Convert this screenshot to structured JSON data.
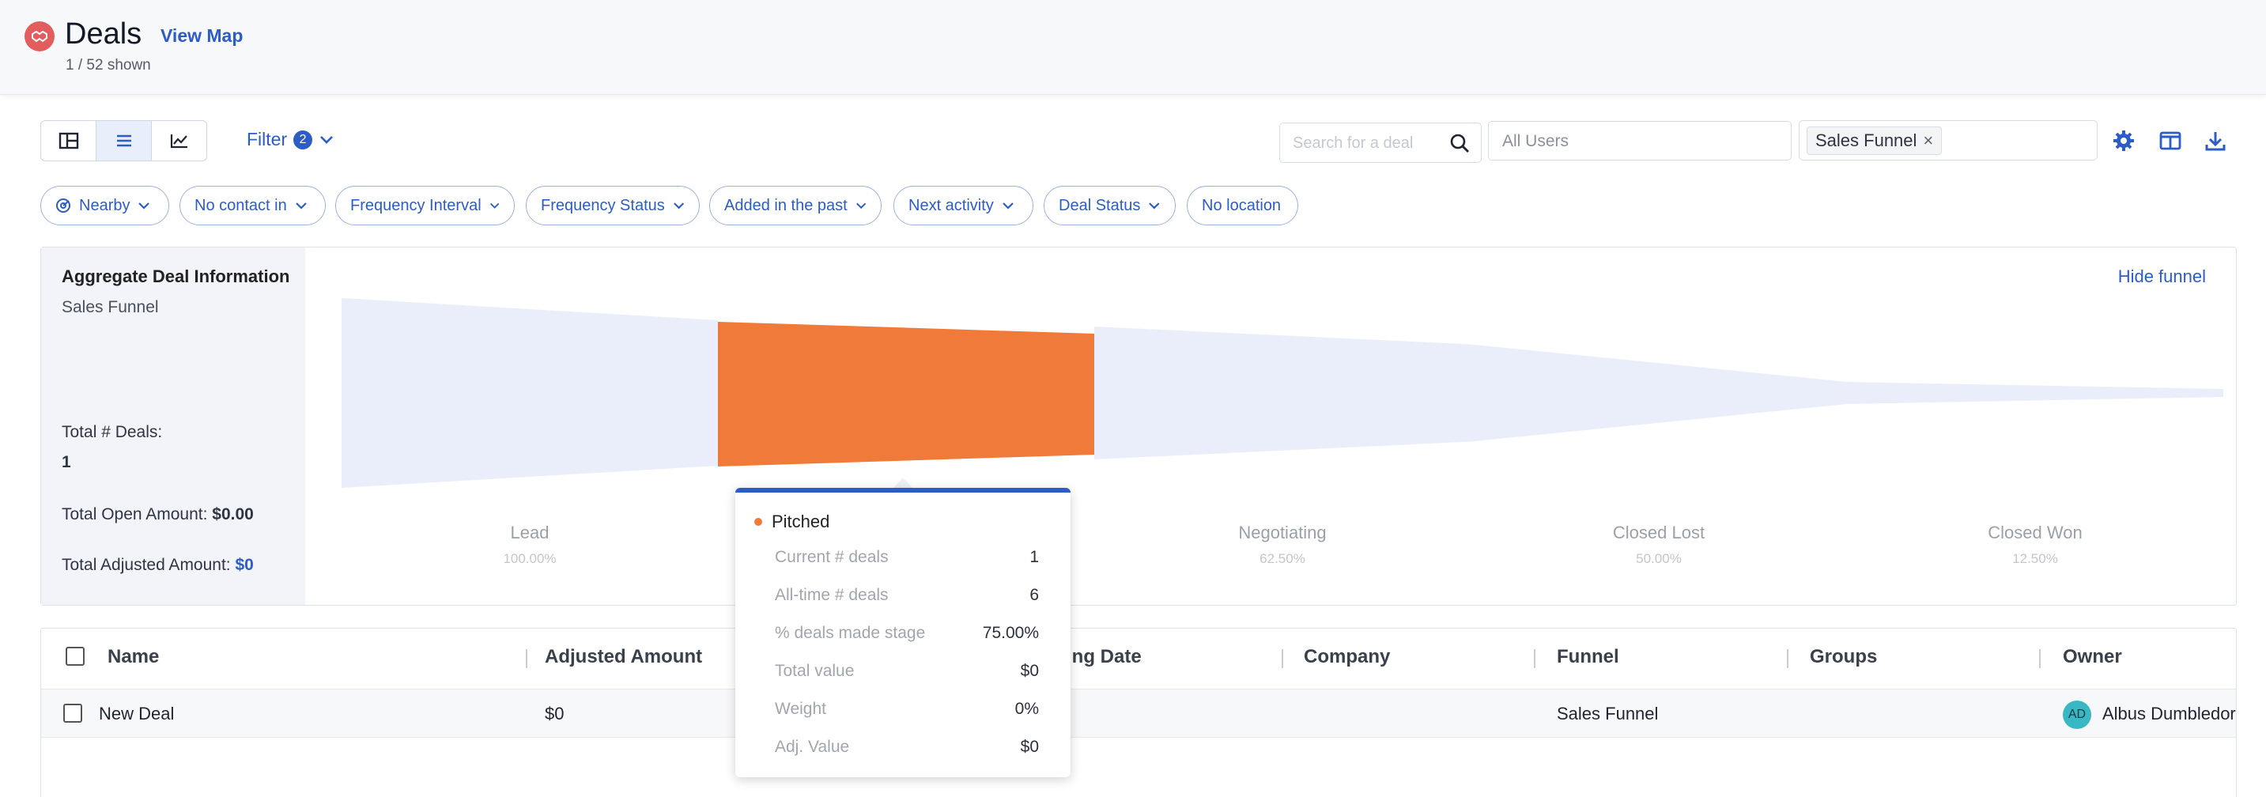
{
  "header": {
    "title": "Deals",
    "view_map": "View Map",
    "shown": "1 / 52 shown"
  },
  "toolbar": {
    "views": [
      "board-view",
      "list-view",
      "chart-view"
    ],
    "active_view": "list-view",
    "filter_label": "Filter",
    "filter_count": "2",
    "search_placeholder": "Search for a deal",
    "users_placeholder": "All Users",
    "funnel_chip": "Sales Funnel"
  },
  "pills": [
    {
      "label": "Nearby",
      "icon": "radar-icon"
    },
    {
      "label": "No contact in"
    },
    {
      "label": "Frequency Interval"
    },
    {
      "label": "Frequency Status"
    },
    {
      "label": "Added in the past"
    },
    {
      "label": "Next activity"
    },
    {
      "label": "Deal Status"
    },
    {
      "label": "No location"
    }
  ],
  "aggregate": {
    "title": "Aggregate Deal Information",
    "subtitle": "Sales Funnel",
    "total_deals_label": "Total # Deals:",
    "total_deals_value": "1",
    "total_open_label": "Total Open Amount:",
    "total_open_value": "$0.00",
    "total_adjusted_label": "Total Adjusted Amount:",
    "total_adjusted_value": "$0",
    "hide_funnel": "Hide funnel"
  },
  "funnel": {
    "stages": [
      {
        "name": "Lead",
        "pct": "100.00%",
        "highlight": false,
        "share": 1.0
      },
      {
        "name": "Pitched",
        "pct": "75.00%",
        "highlight": true,
        "share": 0.75
      },
      {
        "name": "Negotiating",
        "pct": "62.50%",
        "highlight": false,
        "share": 0.625
      },
      {
        "name": "Closed Lost",
        "pct": "50.00%",
        "highlight": false,
        "share": 0.5
      },
      {
        "name": "Closed Won",
        "pct": "12.50%",
        "highlight": false,
        "share": 0.125
      }
    ],
    "colors": {
      "base": "#eaeefa",
      "highlight": "#ef7a3a"
    }
  },
  "tooltip": {
    "stage": "Pitched",
    "rows": [
      {
        "k": "Current # deals",
        "v": "1"
      },
      {
        "k": "All-time # deals",
        "v": "6"
      },
      {
        "k": "% deals made stage",
        "v": "75.00%"
      },
      {
        "k": "Total value",
        "v": "$0"
      },
      {
        "k": "Weight",
        "v": "0%"
      },
      {
        "k": "Adj. Value",
        "v": "$0"
      }
    ]
  },
  "table": {
    "headers": {
      "name": "Name",
      "adjusted": "Adjusted Amount",
      "closing": "Closing Date",
      "company": "Company",
      "funnel": "Funnel",
      "groups": "Groups",
      "owner": "Owner"
    },
    "rows": [
      {
        "name": "New Deal",
        "adjusted": "$0",
        "funnel": "Sales Funnel",
        "owner_initials": "AD",
        "owner": "Albus Dumbledore"
      }
    ]
  }
}
